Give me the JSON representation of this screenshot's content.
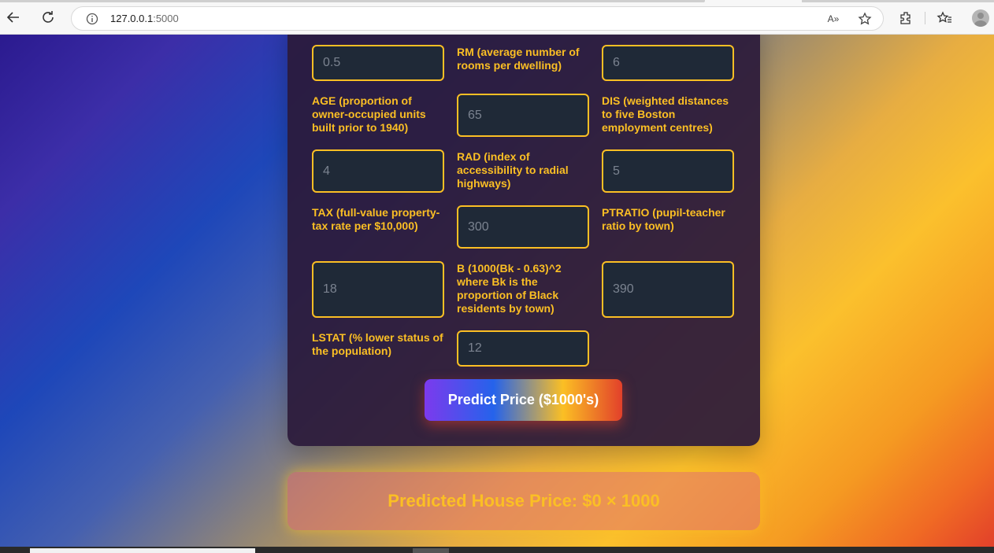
{
  "browser": {
    "url_host": "127.0.0.1",
    "url_port": ":5000",
    "read_aloud_label": "A»"
  },
  "form": {
    "rows": [
      {
        "left_value": "0.5",
        "mid_label": "RM (average number of rooms per dwelling)",
        "right_value": "6"
      },
      {
        "left_label": "AGE (proportion of owner-occupied units built prior to 1940)",
        "mid_value": "65",
        "right_label": "DIS (weighted distances to five Boston employment centres)"
      },
      {
        "left_value": "4",
        "mid_label": "RAD (index of accessibility to radial highways)",
        "right_value": "5"
      },
      {
        "left_label": "TAX (full-value property-tax rate per $10,000)",
        "mid_value": "300",
        "right_label": "PTRATIO (pupil-teacher ratio by town)"
      },
      {
        "left_value": "18",
        "mid_label": "B (1000(Bk - 0.63)^2 where Bk is the proportion of Black residents by town)",
        "right_value": "390"
      },
      {
        "left_label": "LSTAT (% lower status of the population)",
        "mid_value": "12"
      }
    ],
    "submit_label": "Predict Price ($1000's)"
  },
  "result": {
    "text": "Predicted House Price: $0 × 1000"
  },
  "colors": {
    "accent": "#fbbf24",
    "card_bg": "#2b1a3a",
    "input_bg": "#1f2937"
  }
}
